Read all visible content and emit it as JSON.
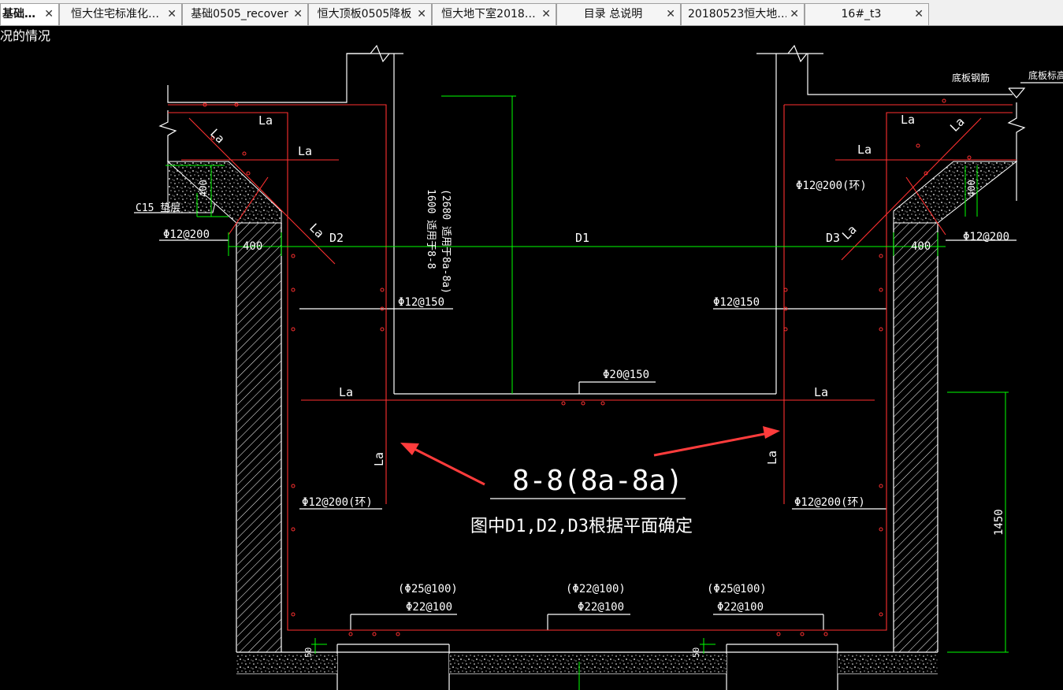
{
  "tabs": [
    {
      "label": "基础…"
    },
    {
      "label": "恒大住宅标准化…"
    },
    {
      "label": "基础0505_recover"
    },
    {
      "label": "恒大顶板0505降板"
    },
    {
      "label": "恒大地下室2018…"
    },
    {
      "label": "目录 总说明"
    },
    {
      "label": "20180523恒大地…"
    },
    {
      "label": "16#_t3"
    }
  ],
  "close_glyph": "✕",
  "drawing": {
    "corner_text": "况的情况",
    "section_title": "8-8(8a-8a)",
    "note": "图中D1,D2,D3根据平面确定",
    "D1": "D1",
    "D2": "D2",
    "D3": "D3",
    "La": "La",
    "dim_400": "400",
    "dim_1450": "1450",
    "dim_50": "50",
    "height_note_1": "1600 适用于8-8",
    "height_note_2": "(2680 适用于8a-8a)",
    "bar_12_200": "Φ12@200",
    "bar_12_200_ring": "Φ12@200(环)",
    "bar_12_150": "Φ12@150",
    "bar_20_150": "Φ20@150",
    "bar_25_100": "(Φ25@100)",
    "bar_22_100": "Φ22@100",
    "bar_22_100_paren": "(Φ22@100)",
    "c15": "C15 垫层",
    "slab_rebar": "底板钢筋",
    "slab_level": "底板标高"
  },
  "colors": {
    "red": "#ff3030",
    "green": "#00ff00",
    "white": "#ffffff",
    "arrow": "#ff3c3c"
  }
}
